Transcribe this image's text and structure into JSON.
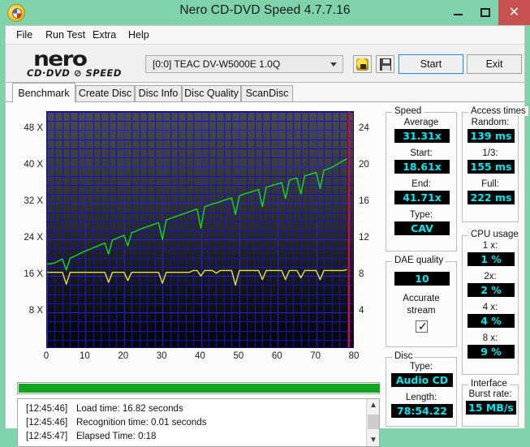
{
  "window": {
    "title": "Nero CD-DVD Speed 4.7.7.16",
    "app_icon": "disc-icon",
    "minimize": "—",
    "maximize": "□",
    "close": "✕",
    "accent_titlebar": "#7ed3ab",
    "close_button_color": "#c75050"
  },
  "menu": [
    {
      "label": "File"
    },
    {
      "label": "Run Test"
    },
    {
      "label": "Extra"
    },
    {
      "label": "Help"
    }
  ],
  "toolbar": {
    "logo_main": "nero",
    "logo_sub": "CD·DVD ⊘ SPEED",
    "drive": "[0:0]   TEAC DV-W5000E 1.0Q",
    "speed_icon": "hand-speed-icon",
    "save_icon": "floppy-save-icon",
    "start_label": "Start",
    "exit_label": "Exit"
  },
  "tabs": [
    {
      "label": "Benchmark",
      "active": true
    },
    {
      "label": "Create Disc",
      "active": false
    },
    {
      "label": "Disc Info",
      "active": false
    },
    {
      "label": "Disc Quality",
      "active": false
    },
    {
      "label": "ScanDisc",
      "active": false
    }
  ],
  "chart_data": {
    "type": "line",
    "title": "",
    "xlabel": "",
    "ylabel": "",
    "xlim": [
      0,
      80
    ],
    "ylim": [
      0,
      52
    ],
    "y2lim": [
      0,
      26
    ],
    "grid": true,
    "legend": "none",
    "x_ticks": [
      0,
      10,
      20,
      30,
      40,
      50,
      60,
      70,
      80
    ],
    "y_ticks_left": [
      "8 X",
      "16 X",
      "24 X",
      "32 X",
      "40 X",
      "48 X"
    ],
    "y_tick_values_left": [
      8,
      16,
      24,
      32,
      40,
      48
    ],
    "y_ticks_right": [
      "4",
      "8",
      "12",
      "16",
      "20",
      "24"
    ],
    "y_tick_values_right": [
      4,
      8,
      12,
      16,
      20,
      24
    ],
    "end_marker_x": 78.5,
    "end_marker_color": "#e01010",
    "series": [
      {
        "name": "Transfer rate",
        "color": "#16dc16",
        "axis": "left",
        "x": [
          0,
          1,
          2,
          3,
          4,
          5,
          6,
          7,
          8,
          9,
          10,
          11,
          12,
          13,
          14,
          15,
          16,
          17,
          18,
          19,
          20,
          21,
          22,
          23,
          24,
          25,
          26,
          27,
          28,
          29,
          30,
          31,
          32,
          33,
          34,
          35,
          36,
          37,
          38,
          39,
          40,
          41,
          42,
          43,
          44,
          45,
          46,
          47,
          48,
          49,
          50,
          51,
          52,
          53,
          54,
          55,
          56,
          57,
          58,
          59,
          60,
          61,
          62,
          63,
          64,
          65,
          66,
          67,
          68,
          69,
          70,
          71,
          72,
          73,
          74,
          75,
          76,
          77,
          78
        ],
        "values": [
          18.6,
          18.7,
          18.9,
          19.3,
          19.7,
          17.3,
          19.9,
          20.3,
          20.7,
          21.1,
          21.5,
          21.8,
          22.2,
          22.5,
          22.9,
          23.2,
          20.8,
          23.9,
          24.2,
          24.6,
          24.9,
          22.6,
          25.5,
          25.8,
          26.2,
          26.5,
          26.8,
          27.1,
          27.4,
          27.7,
          24.0,
          28.3,
          28.6,
          28.9,
          29.2,
          29.5,
          29.8,
          30.1,
          30.4,
          30.7,
          26.5,
          31.2,
          31.5,
          31.8,
          32.0,
          32.3,
          32.6,
          32.9,
          33.1,
          29.5,
          33.6,
          33.9,
          34.2,
          34.4,
          34.7,
          35.0,
          31.2,
          35.5,
          35.7,
          36.0,
          36.2,
          36.5,
          33.0,
          37.0,
          37.3,
          37.5,
          34.0,
          38.0,
          38.2,
          38.5,
          38.7,
          35.2,
          39.2,
          39.5,
          39.8,
          40.3,
          40.8,
          41.3,
          41.71
        ]
      },
      {
        "name": "CPU / access",
        "color": "#e8e820",
        "axis": "right",
        "x": [
          0,
          1,
          2,
          3,
          4,
          5,
          6,
          7,
          8,
          9,
          10,
          11,
          12,
          13,
          14,
          15,
          16,
          17,
          18,
          19,
          20,
          21,
          22,
          23,
          24,
          25,
          26,
          27,
          28,
          29,
          30,
          31,
          32,
          33,
          34,
          35,
          36,
          37,
          38,
          39,
          40,
          41,
          42,
          43,
          44,
          45,
          46,
          47,
          48,
          49,
          50,
          51,
          52,
          53,
          54,
          55,
          56,
          57,
          58,
          59,
          60,
          61,
          62,
          63,
          64,
          65,
          66,
          67,
          68,
          69,
          70,
          71,
          72,
          73,
          74,
          75,
          76,
          77,
          78
        ],
        "values": [
          8.4,
          8.4,
          8.4,
          8.4,
          8.4,
          7.1,
          8.4,
          8.4,
          8.4,
          8.4,
          8.4,
          8.4,
          8.4,
          8.4,
          8.4,
          8.4,
          7.3,
          8.4,
          8.4,
          8.4,
          8.4,
          7.5,
          8.4,
          8.4,
          8.4,
          8.4,
          8.4,
          8.4,
          8.4,
          8.4,
          7.2,
          8.4,
          8.4,
          8.4,
          8.4,
          8.4,
          8.4,
          8.4,
          8.6,
          8.6,
          8.0,
          8.6,
          8.6,
          8.6,
          8.3,
          8.6,
          8.6,
          8.6,
          8.6,
          7.0,
          8.6,
          8.6,
          8.6,
          8.6,
          8.6,
          8.6,
          7.6,
          8.6,
          8.6,
          8.6,
          8.6,
          8.6,
          7.6,
          8.6,
          8.6,
          8.6,
          7.8,
          8.6,
          8.6,
          8.6,
          8.6,
          7.6,
          8.6,
          8.6,
          8.6,
          8.6,
          8.6,
          8.6,
          8.7
        ]
      }
    ]
  },
  "progress": {
    "percent": 100,
    "color": "#11a522"
  },
  "log": {
    "entries": [
      {
        "time": "[12:45:46]",
        "text": "Load time: 16.82 seconds"
      },
      {
        "time": "[12:45:46]",
        "text": "Recognition time: 0.01 seconds"
      },
      {
        "time": "[12:45:47]",
        "text": "Elapsed Time:  0:18"
      }
    ],
    "scroll_up_icon": "chevron-up-icon",
    "scroll_down_icon": "chevron-down-icon"
  },
  "panels": {
    "speed": {
      "legend": "Speed",
      "fields": [
        {
          "label": "Average",
          "value": "31.31x"
        },
        {
          "label": "Start:",
          "value": "18.61x"
        },
        {
          "label": "End:",
          "value": "41.71x"
        },
        {
          "label": "Type:",
          "value": "CAV"
        }
      ]
    },
    "dae": {
      "legend": "DAE quality",
      "value": "10",
      "accurate_line1": "Accurate",
      "accurate_line2": "stream",
      "accurate_checked": true
    },
    "disc": {
      "legend": "Disc",
      "fields": [
        {
          "label": "Type:",
          "value": "Audio CD"
        },
        {
          "label": "Length:",
          "value": "78:54.22"
        }
      ]
    },
    "access": {
      "legend": "Access times",
      "fields": [
        {
          "label": "Random:",
          "value": "139 ms"
        },
        {
          "label": "1/3:",
          "value": "155 ms"
        },
        {
          "label": "Full:",
          "value": "222 ms"
        }
      ]
    },
    "cpu": {
      "legend": "CPU usage",
      "fields": [
        {
          "label": "1 x:",
          "value": "1 %"
        },
        {
          "label": "2x:",
          "value": "2 %"
        },
        {
          "label": "4 x:",
          "value": "4 %"
        },
        {
          "label": "8 x:",
          "value": "9 %"
        }
      ]
    },
    "interface": {
      "legend": "Interface",
      "fields": [
        {
          "label": "Burst rate:",
          "value": "15 MB/s"
        }
      ]
    }
  },
  "lcd_colors": {
    "bg": "#000000",
    "fg": "#00e8ef"
  }
}
